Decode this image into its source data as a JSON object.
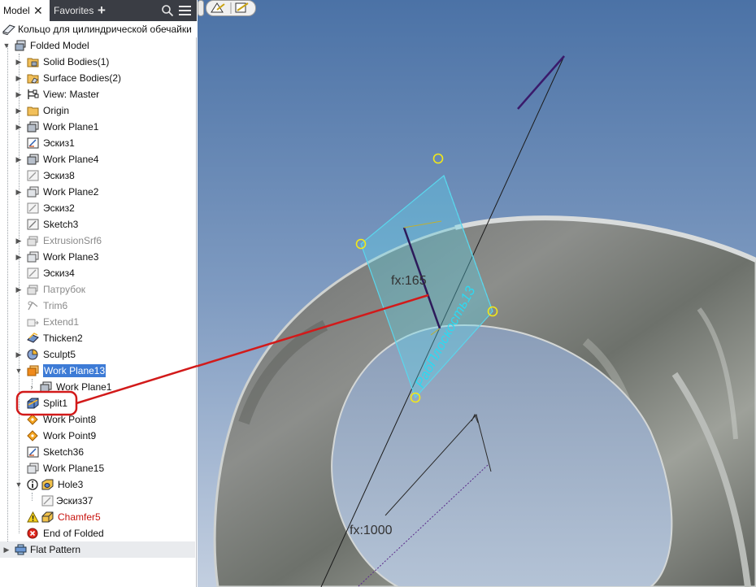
{
  "tabs": {
    "model": "Model",
    "model_close": "✕",
    "favorites": "Favorites",
    "add": "+"
  },
  "tree": {
    "root": "Кольцо для цилиндрической обечайки",
    "items": [
      {
        "label": "Folded Model",
        "icon": "folded-model-icon"
      },
      {
        "label": "Solid Bodies(1)",
        "icon": "solid-bodies-folder-icon"
      },
      {
        "label": "Surface Bodies(2)",
        "icon": "surface-bodies-folder-icon"
      },
      {
        "label": "View: Master",
        "icon": "view-icon"
      },
      {
        "label": "Origin",
        "icon": "folder-icon"
      },
      {
        "label": "Work Plane1",
        "icon": "work-plane-icon"
      },
      {
        "label": "Эскиз1",
        "icon": "sketch-icon"
      },
      {
        "label": "Work Plane4",
        "icon": "work-plane-icon"
      },
      {
        "label": "Эскиз8",
        "icon": "sketch-icon"
      },
      {
        "label": "Work Plane2",
        "icon": "work-plane-icon"
      },
      {
        "label": "Эскиз2",
        "icon": "sketch-icon"
      },
      {
        "label": "Sketch3",
        "icon": "sketch-icon"
      },
      {
        "label": "ExtrusionSrf6",
        "icon": "extrusion-surface-icon"
      },
      {
        "label": "Work Plane3",
        "icon": "work-plane-icon"
      },
      {
        "label": "Эскиз4",
        "icon": "sketch-icon"
      },
      {
        "label": "Патрубок",
        "icon": "extrusion-surface-icon"
      },
      {
        "label": "Trim6",
        "icon": "trim-icon"
      },
      {
        "label": "Extend1",
        "icon": "extend-icon"
      },
      {
        "label": "Thicken2",
        "icon": "thicken-icon"
      },
      {
        "label": "Sculpt5",
        "icon": "sculpt-icon"
      },
      {
        "label": "Work Plane13",
        "icon": "work-plane-orange-icon"
      },
      {
        "label": "Work Plane1",
        "icon": "work-plane-icon"
      },
      {
        "label": "Split1",
        "icon": "split-icon"
      },
      {
        "label": "Work Point8",
        "icon": "work-point-icon"
      },
      {
        "label": "Work Point9",
        "icon": "work-point-icon"
      },
      {
        "label": "Sketch36",
        "icon": "sketch-icon"
      },
      {
        "label": "Work Plane15",
        "icon": "work-plane-icon"
      },
      {
        "label": "Hole3",
        "icon": "hole-icon"
      },
      {
        "label": "Эскиз37",
        "icon": "sketch-icon"
      },
      {
        "label": "Chamfer5",
        "icon": "chamfer-icon"
      },
      {
        "label": "End of Folded",
        "icon": "end-of-part-icon"
      },
      {
        "label": "Flat Pattern",
        "icon": "flat-pattern-icon"
      }
    ]
  },
  "viewport": {
    "dimension_upper": "fx:165",
    "dimension_lower": "fx:1000",
    "plane_label": "РабПлоскость13"
  },
  "colors": {
    "selection": "#3d7bd6",
    "annotation": "#d21a1a",
    "plane": "#59d4ea",
    "error_text": "#c8140f"
  }
}
